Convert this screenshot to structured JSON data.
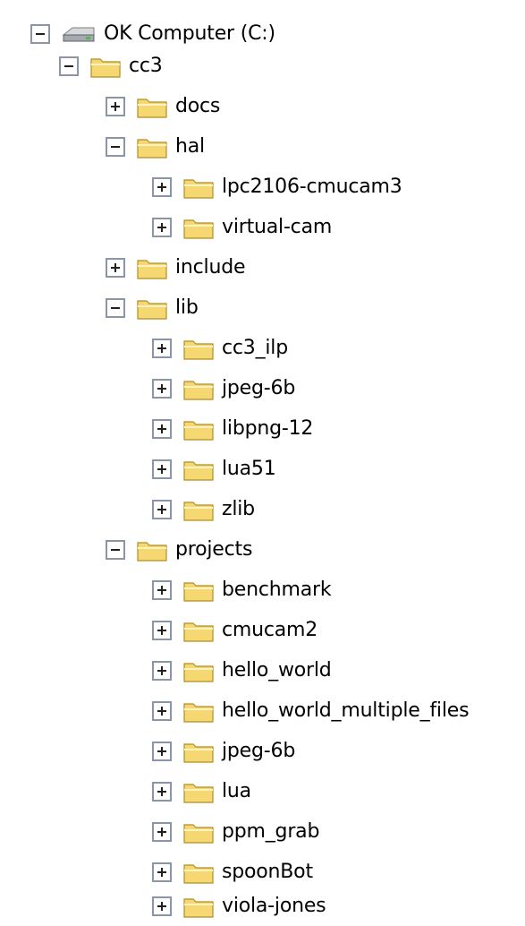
{
  "tree": {
    "root": {
      "label": "OK Computer (C:)",
      "icon": "hard-drive-icon",
      "expanded": true
    },
    "nodes": [
      {
        "label": "cc3",
        "icon": "folder-icon",
        "expanded": true
      },
      {
        "label": "docs",
        "icon": "folder-icon",
        "expanded": false
      },
      {
        "label": "hal",
        "icon": "folder-icon",
        "expanded": true
      },
      {
        "label": "lpc2106-cmucam3",
        "icon": "folder-icon",
        "expanded": false
      },
      {
        "label": "virtual-cam",
        "icon": "folder-icon",
        "expanded": false
      },
      {
        "label": "include",
        "icon": "folder-icon",
        "expanded": false
      },
      {
        "label": "lib",
        "icon": "folder-icon",
        "expanded": true
      },
      {
        "label": "cc3_ilp",
        "icon": "folder-icon",
        "expanded": false
      },
      {
        "label": "jpeg-6b",
        "icon": "folder-icon",
        "expanded": false
      },
      {
        "label": "libpng-12",
        "icon": "folder-icon",
        "expanded": false
      },
      {
        "label": "lua51",
        "icon": "folder-icon",
        "expanded": false
      },
      {
        "label": "zlib",
        "icon": "folder-icon",
        "expanded": false
      },
      {
        "label": "projects",
        "icon": "folder-icon",
        "expanded": true
      },
      {
        "label": "benchmark",
        "icon": "folder-icon",
        "expanded": false
      },
      {
        "label": "cmucam2",
        "icon": "folder-icon",
        "expanded": false
      },
      {
        "label": "hello_world",
        "icon": "folder-icon",
        "expanded": false
      },
      {
        "label": "hello_world_multiple_files",
        "icon": "folder-icon",
        "expanded": false
      },
      {
        "label": "jpeg-6b",
        "icon": "folder-icon",
        "expanded": false
      },
      {
        "label": "lua",
        "icon": "folder-icon",
        "expanded": false
      },
      {
        "label": "ppm_grab",
        "icon": "folder-icon",
        "expanded": false
      },
      {
        "label": "spoonBot",
        "icon": "folder-icon",
        "expanded": false
      },
      {
        "label": "viola-jones",
        "icon": "folder-icon",
        "expanded": false
      }
    ]
  },
  "colors": {
    "expander_border": "#8a96a8",
    "folder_fill": "#f6d873",
    "folder_stroke": "#b58e21"
  }
}
